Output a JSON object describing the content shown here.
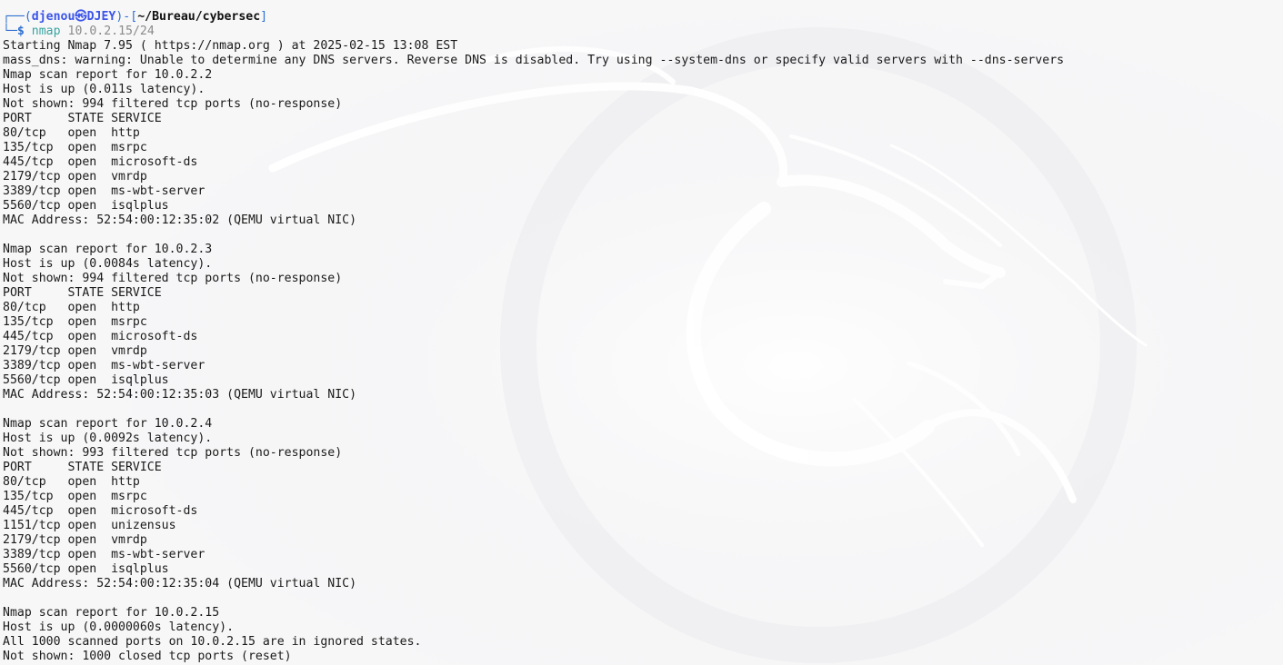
{
  "prompt": {
    "top_prefix": "┌──(",
    "user": "djenou",
    "at_symbol": "㉿",
    "host": "DJEY",
    "mid": ")-[",
    "dir": "~/Bureau/cybersec",
    "close": "]",
    "bottom_prefix": "└─",
    "dollar": "$",
    "command": "nmap",
    "argument": "10.0.2.15/24"
  },
  "output_lines": [
    "Starting Nmap 7.95 ( https://nmap.org ) at 2025-02-15 13:08 EST",
    "mass_dns: warning: Unable to determine any DNS servers. Reverse DNS is disabled. Try using --system-dns or specify valid servers with --dns-servers",
    "Nmap scan report for 10.0.2.2",
    "Host is up (0.011s latency).",
    "Not shown: 994 filtered tcp ports (no-response)",
    "PORT     STATE SERVICE",
    "80/tcp   open  http",
    "135/tcp  open  msrpc",
    "445/tcp  open  microsoft-ds",
    "2179/tcp open  vmrdp",
    "3389/tcp open  ms-wbt-server",
    "5560/tcp open  isqlplus",
    "MAC Address: 52:54:00:12:35:02 (QEMU virtual NIC)",
    "",
    "Nmap scan report for 10.0.2.3",
    "Host is up (0.0084s latency).",
    "Not shown: 994 filtered tcp ports (no-response)",
    "PORT     STATE SERVICE",
    "80/tcp   open  http",
    "135/tcp  open  msrpc",
    "445/tcp  open  microsoft-ds",
    "2179/tcp open  vmrdp",
    "3389/tcp open  ms-wbt-server",
    "5560/tcp open  isqlplus",
    "MAC Address: 52:54:00:12:35:03 (QEMU virtual NIC)",
    "",
    "Nmap scan report for 10.0.2.4",
    "Host is up (0.0092s latency).",
    "Not shown: 993 filtered tcp ports (no-response)",
    "PORT     STATE SERVICE",
    "80/tcp   open  http",
    "135/tcp  open  msrpc",
    "445/tcp  open  microsoft-ds",
    "1151/tcp open  unizensus",
    "2179/tcp open  vmrdp",
    "3389/tcp open  ms-wbt-server",
    "5560/tcp open  isqlplus",
    "MAC Address: 52:54:00:12:35:04 (QEMU virtual NIC)",
    "",
    "Nmap scan report for 10.0.2.15",
    "Host is up (0.0000060s latency).",
    "All 1000 scanned ports on 10.0.2.15 are in ignored states.",
    "Not shown: 1000 closed tcp ports (reset)"
  ],
  "colors": {
    "background": "#f7f7f8",
    "text": "#1a1a1a",
    "prompt_frame": "#2f6fd0",
    "user_host": "#3c55e8",
    "command": "#3aa3a0",
    "argument": "#8a8a8a"
  }
}
